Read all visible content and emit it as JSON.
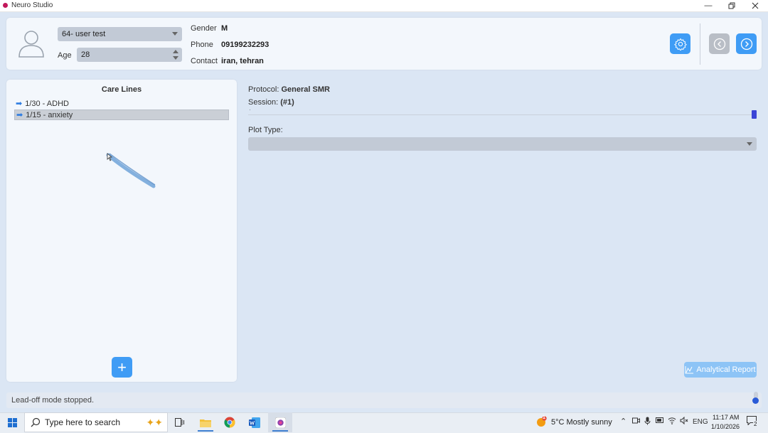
{
  "window": {
    "title": "Neuro Studio",
    "controls": [
      "minimize",
      "restore",
      "close"
    ]
  },
  "header": {
    "user_select": {
      "value": "64- user test"
    },
    "age": {
      "label": "Age",
      "value": "28"
    },
    "gender": {
      "label": "Gender",
      "value": "M"
    },
    "phone": {
      "label": "Phone",
      "value": "09199232293"
    },
    "contact": {
      "label": "Contact",
      "value": "iran, tehran"
    },
    "icons": [
      "user-avatar-icon",
      "gear-icon",
      "chevron-left-icon",
      "chevron-right-icon"
    ],
    "accent_color": "#3f9cf5"
  },
  "care_lines": {
    "title": "Care Lines",
    "items": [
      {
        "arrow": "➡",
        "label": "1/30  - ADHD",
        "selected": false
      },
      {
        "arrow": "➡",
        "label": "1/15  - anxiety",
        "selected": true
      }
    ],
    "add_icon": "+"
  },
  "protocol": {
    "label": "Protocol:",
    "value": "General SMR",
    "session_label": "Session:",
    "session_value": "(#1)",
    "session_handle_color": "#3b45d6"
  },
  "plot_type": {
    "label": "Plot Type:",
    "value": ""
  },
  "report_button": {
    "label": "Analytical Report",
    "icon": "chart-line-icon"
  },
  "status": {
    "text": "Lead-off mode stopped."
  },
  "taskbar": {
    "search_placeholder": "Type here to search",
    "weather": "5°C  Mostly sunny",
    "weather_badge": "1",
    "language": "ENG",
    "time": "11:17 AM",
    "date": "1/10/2026",
    "notifications": "2",
    "pinned_icons": [
      "windows-start-icon",
      "task-view-icon",
      "file-explorer-icon",
      "chrome-icon",
      "word-icon",
      "neuro-studio-icon"
    ]
  }
}
